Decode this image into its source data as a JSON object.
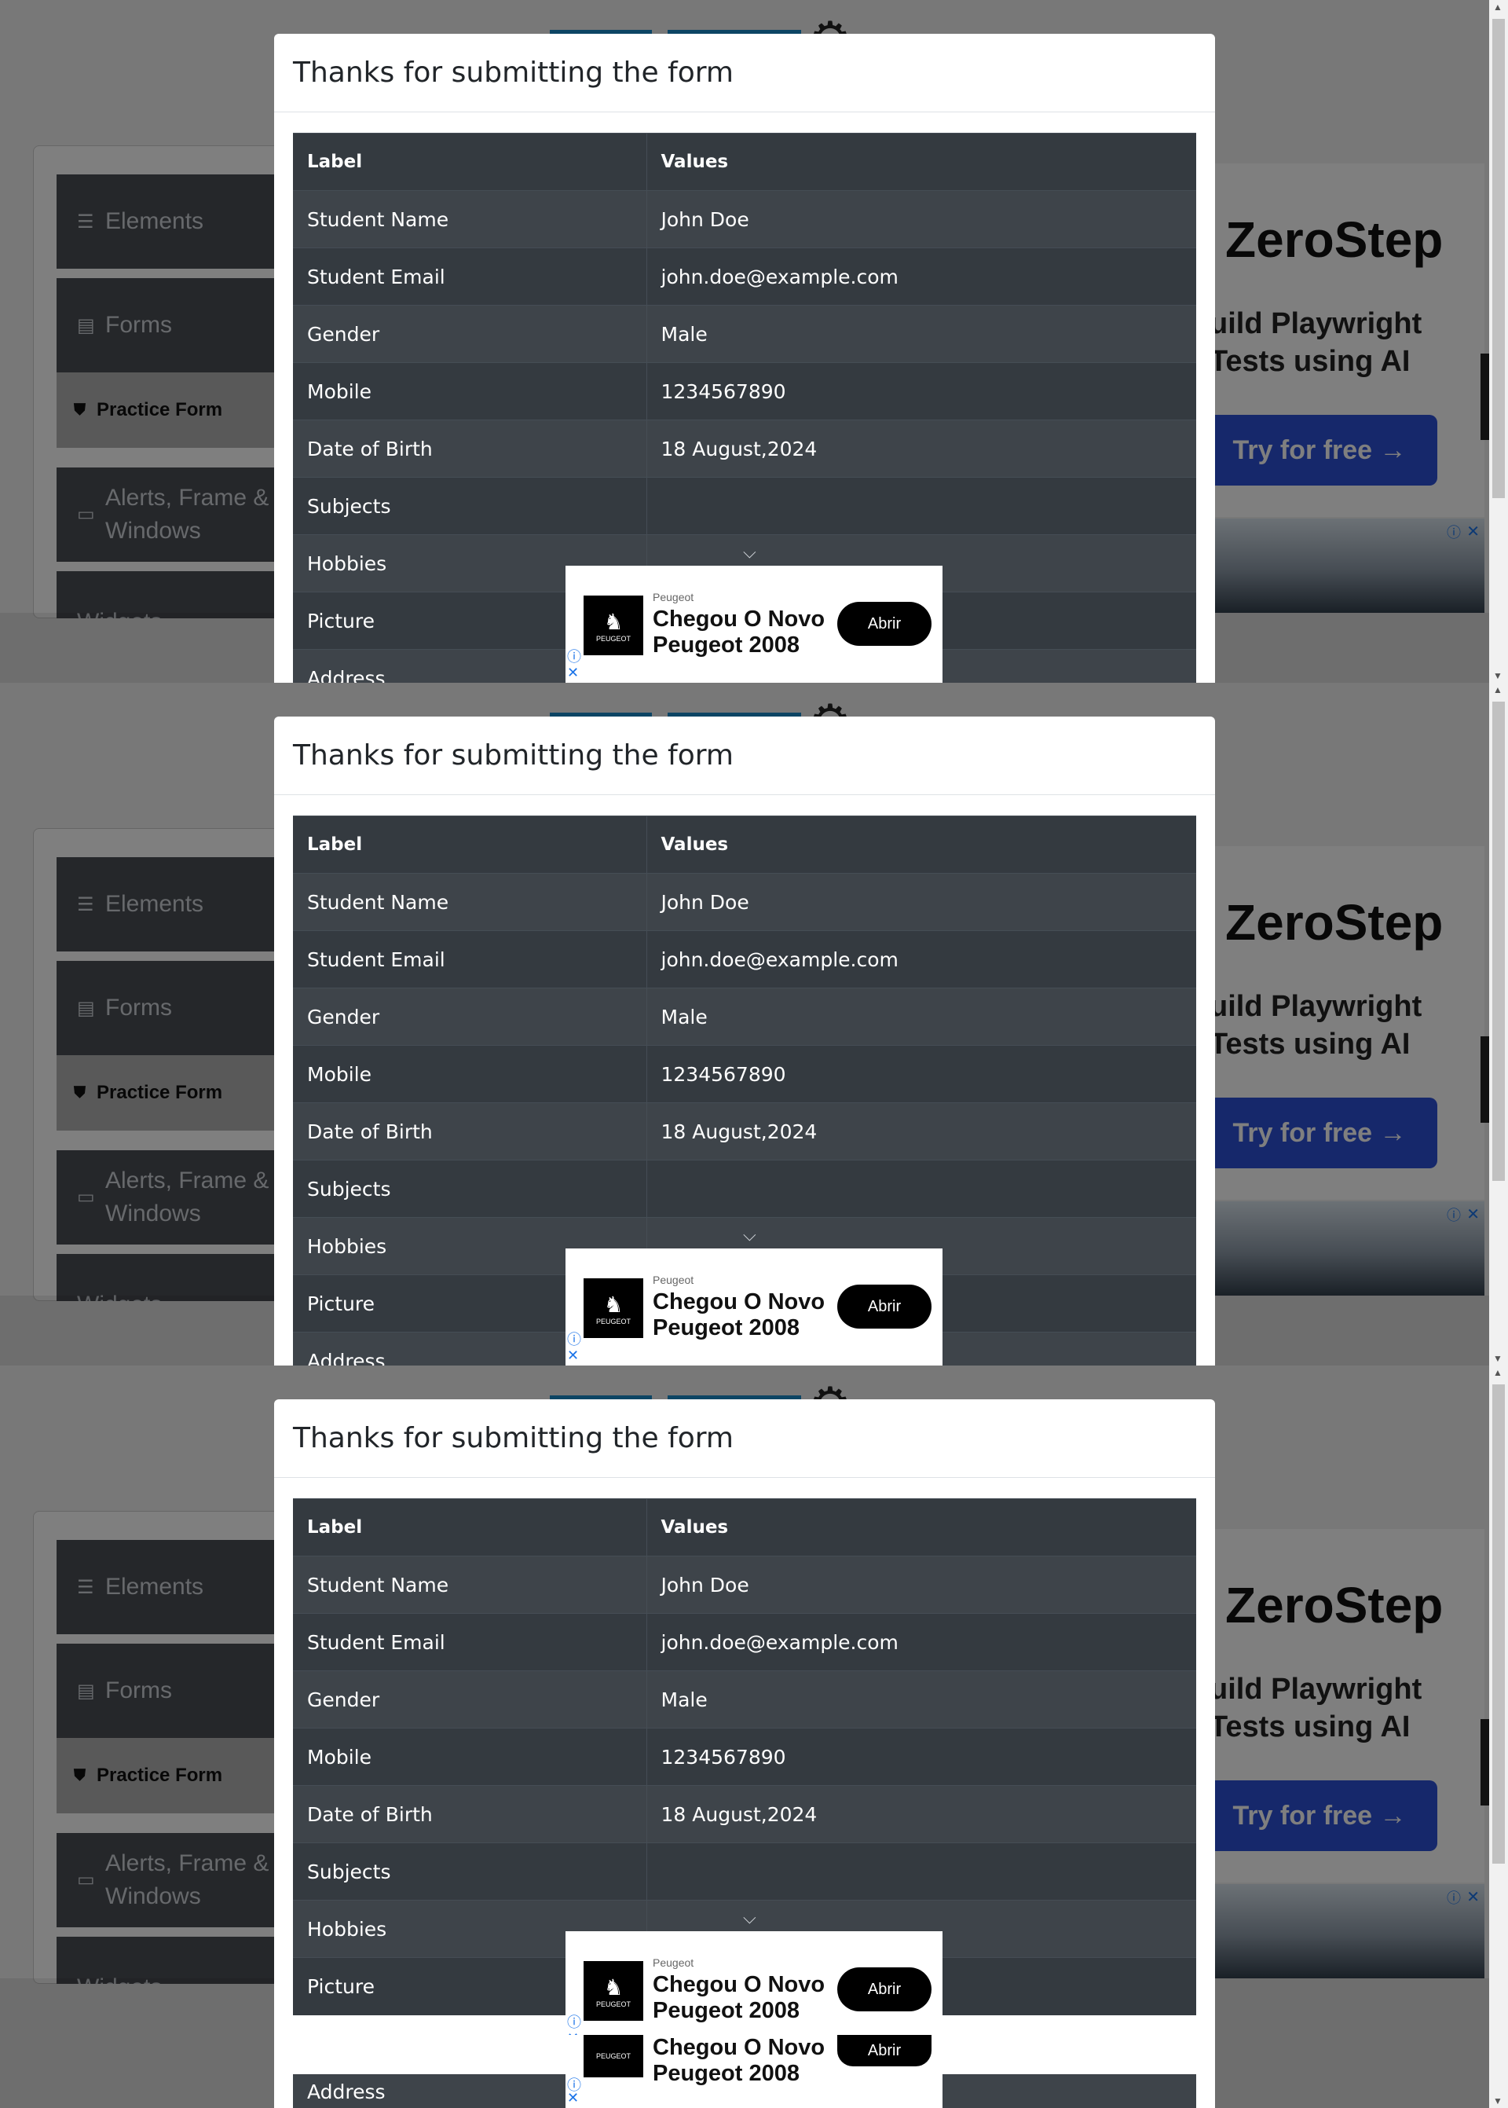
{
  "sidebar": {
    "elements_label": "Elements",
    "forms_label": "Forms",
    "practice_form_label": "Practice Form",
    "alerts_label": "Alerts, Frame & Windows",
    "widgets_label": "Widgets"
  },
  "ad_right": {
    "title": "ZeroStep",
    "subtitle_line1": "uild Playwright",
    "subtitle_line2": "Tests using AI",
    "button": "Try for free →"
  },
  "modal": {
    "title": "Thanks for submitting the form",
    "header_label": "Label",
    "header_values": "Values",
    "rows": [
      {
        "label": "Student Name",
        "value": "John Doe"
      },
      {
        "label": "Student Email",
        "value": "john.doe@example.com"
      },
      {
        "label": "Gender",
        "value": "Male"
      },
      {
        "label": "Mobile",
        "value": "1234567890"
      },
      {
        "label": "Date of Birth",
        "value": "18 August,2024"
      },
      {
        "label": "Subjects",
        "value": ""
      },
      {
        "label": "Hobbies",
        "value": ""
      },
      {
        "label": "Picture",
        "value": ""
      },
      {
        "label": "Address",
        "value": ""
      }
    ]
  },
  "peugeot_ad": {
    "brand": "Peugeot",
    "logo_text": "PEUGEOT",
    "headline": "Chegou O Novo Peugeot 2008",
    "button": "Abrir"
  },
  "icons": {
    "menu": "hamburger-icon",
    "forms": "document-icon",
    "practice": "html5-icon",
    "alerts": "window-icon",
    "chevron": "chevron-down-icon",
    "info": "info-icon",
    "close": "close-icon"
  },
  "colors": {
    "table_dark": "#343a40",
    "table_odd": "#3e444a",
    "sidebar": "#4b4f54",
    "accent_blue": "#2d50d6"
  }
}
